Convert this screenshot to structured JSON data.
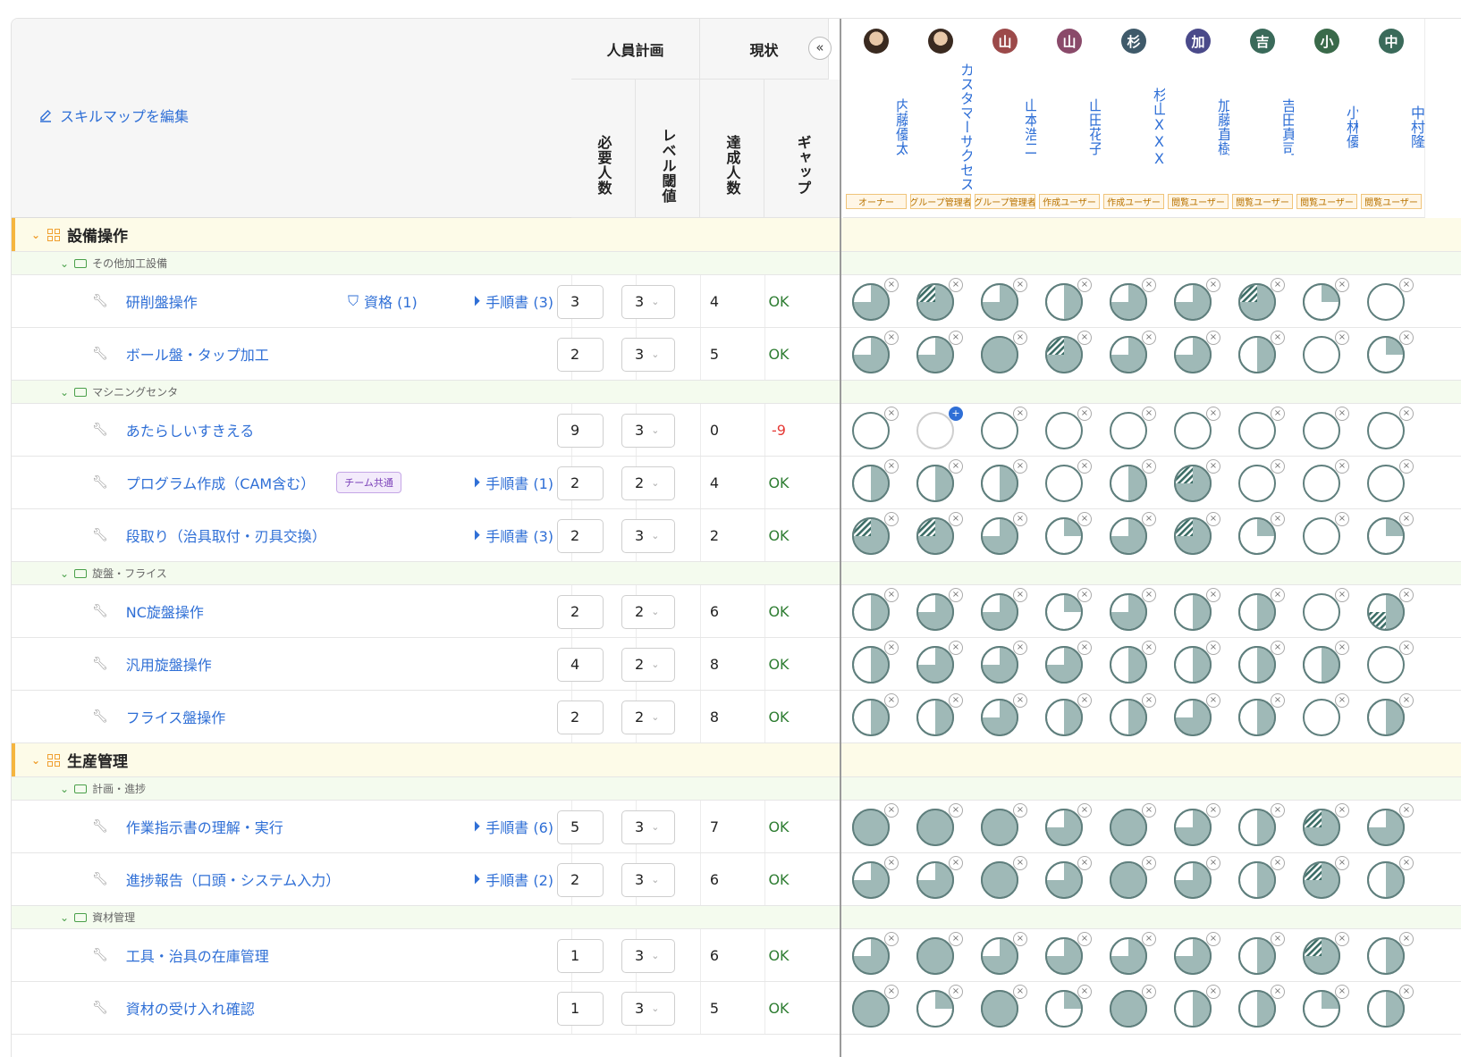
{
  "edit_skillmap_label": "スキルマップを編集",
  "header": {
    "plan": "人員計画",
    "status": "現状",
    "required": "必要人数",
    "level_threshold": "レベル閾値",
    "achieved": "達成人数",
    "gap": "ギャップ"
  },
  "collapse_label": "«",
  "users": [
    {
      "name": "内藤優太",
      "initial": "",
      "photo": true,
      "color": "#333333",
      "role": "オーナー"
    },
    {
      "name": "カスタマーサクセス",
      "initial": "",
      "photo": true,
      "color": "#555555",
      "role": "グループ管理者"
    },
    {
      "name": "山本浩二",
      "initial": "山",
      "photo": false,
      "color": "#9c4a4a",
      "role": "グループ管理者"
    },
    {
      "name": "山田花子",
      "initial": "山",
      "photo": false,
      "color": "#8a4a6a",
      "role": "作成ユーザー"
    },
    {
      "name": "杉山XXX",
      "initial": "杉",
      "photo": false,
      "color": "#3f5a6a",
      "role": "作成ユーザー"
    },
    {
      "name": "加藤直樹",
      "initial": "加",
      "photo": false,
      "color": "#4a4a8a",
      "role": "閲覧ユーザー"
    },
    {
      "name": "吉田真司",
      "initial": "吉",
      "photo": false,
      "color": "#3a6a5a",
      "role": "閲覧ユーザー"
    },
    {
      "name": "小林優",
      "initial": "小",
      "photo": false,
      "color": "#3a6a4a",
      "role": "閲覧ユーザー"
    },
    {
      "name": "中村隆",
      "initial": "中",
      "photo": false,
      "color": "#3a6a5a",
      "role": "閲覧ユーザー"
    }
  ],
  "colors": {
    "fill": "#9fb9b7",
    "stroke": "#5f7f7d",
    "hatch": "#3c6d66",
    "accent": "#2f6fd6"
  },
  "rows": [
    {
      "type": "category",
      "title": "設備操作"
    },
    {
      "type": "sub",
      "title": "その他加工設備"
    },
    {
      "type": "skill",
      "name": "研削盤操作",
      "qual": "資格 (1)",
      "manual": "手順書 (3)",
      "required": "3",
      "level": "3",
      "achieved": "4",
      "gap": "OK",
      "levels": [
        3,
        "3h",
        3,
        2,
        3,
        3,
        "3h",
        1,
        0
      ]
    },
    {
      "type": "skill",
      "name": "ボール盤・タップ加工",
      "required": "2",
      "level": "3",
      "achieved": "5",
      "gap": "OK",
      "levels": [
        3,
        3,
        4,
        "3h",
        3,
        3,
        2,
        0,
        1
      ]
    },
    {
      "type": "sub",
      "title": "マシニングセンタ"
    },
    {
      "type": "skill",
      "name": "あたらしいすきえる",
      "required": "9",
      "level": "3",
      "achieved": "0",
      "gap": "-9",
      "levels": [
        0,
        "empty",
        0,
        0,
        0,
        0,
        0,
        0,
        0
      ]
    },
    {
      "type": "skill",
      "name": "プログラム作成（CAM含む）",
      "team": "チーム共通",
      "manual": "手順書 (1)",
      "required": "2",
      "level": "2",
      "achieved": "4",
      "gap": "OK",
      "levels": [
        2,
        2,
        2,
        0,
        2,
        "3h",
        0,
        0,
        0
      ]
    },
    {
      "type": "skill",
      "name": "段取り（治具取付・刃具交換）",
      "manual": "手順書 (3)",
      "required": "2",
      "level": "3",
      "achieved": "2",
      "gap": "OK",
      "levels": [
        "3h",
        "3h",
        3,
        1,
        3,
        "3h",
        1,
        0,
        1
      ]
    },
    {
      "type": "sub",
      "title": "旋盤・フライス"
    },
    {
      "type": "skill",
      "name": "NC旋盤操作",
      "required": "2",
      "level": "2",
      "achieved": "6",
      "gap": "OK",
      "levels": [
        2,
        3,
        3,
        1,
        3,
        2,
        2,
        0,
        "2h"
      ]
    },
    {
      "type": "skill",
      "name": "汎用旋盤操作",
      "required": "4",
      "level": "2",
      "achieved": "8",
      "gap": "OK",
      "levels": [
        2,
        3,
        3,
        3,
        2,
        2,
        2,
        2,
        0
      ]
    },
    {
      "type": "skill",
      "name": "フライス盤操作",
      "required": "2",
      "level": "2",
      "achieved": "8",
      "gap": "OK",
      "levels": [
        2,
        2,
        3,
        2,
        2,
        3,
        2,
        0,
        2
      ]
    },
    {
      "type": "category",
      "title": "生産管理"
    },
    {
      "type": "sub",
      "title": "計画・進捗"
    },
    {
      "type": "skill",
      "name": "作業指示書の理解・実行",
      "manual": "手順書 (6)",
      "required": "5",
      "level": "3",
      "achieved": "7",
      "gap": "OK",
      "levels": [
        4,
        4,
        4,
        3,
        4,
        3,
        2,
        "3h",
        3
      ]
    },
    {
      "type": "skill",
      "name": "進捗報告（口頭・システム入力）",
      "manual": "手順書 (2)",
      "required": "2",
      "level": "3",
      "achieved": "6",
      "gap": "OK",
      "levels": [
        3,
        3,
        4,
        3,
        4,
        3,
        2,
        "3h",
        2
      ]
    },
    {
      "type": "sub",
      "title": "資材管理"
    },
    {
      "type": "skill",
      "name": "工具・治具の在庫管理",
      "required": "1",
      "level": "3",
      "achieved": "6",
      "gap": "OK",
      "levels": [
        3,
        4,
        3,
        3,
        3,
        3,
        2,
        "3h",
        2
      ]
    },
    {
      "type": "skill",
      "name": "資材の受け入れ確認",
      "required": "1",
      "level": "3",
      "achieved": "5",
      "gap": "OK",
      "levels": [
        4,
        1,
        4,
        1,
        4,
        2,
        2,
        1,
        2
      ]
    }
  ]
}
